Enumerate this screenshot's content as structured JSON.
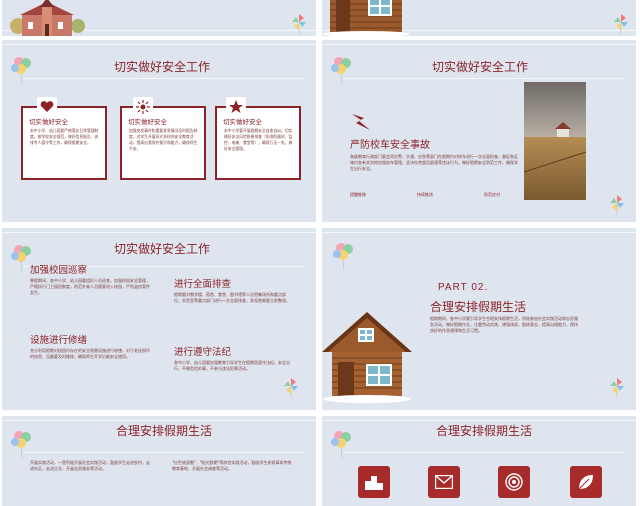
{
  "colors": {
    "accent": "#8b2328",
    "slide_bg": "#dfe5ee",
    "brand_red": "#a82b2b"
  },
  "slide3": {
    "title": "切实做好安全工作",
    "cards": [
      {
        "icon": "heart-icon",
        "title": "切实做好安全",
        "body": "本中小学、幼儿园要严格落实日常管理制度，按学校安全规范，做好信息报告、安排专人值守等工作，确保假期安全。"
      },
      {
        "icon": "sun-icon",
        "title": "切实做好安全",
        "body": "加强突发事件和重要紧急情况及时报告制度，对学生开展形式多样的安全教育活动，提高自我保护意识和能力，确保师生平安。"
      },
      {
        "icon": "star-icon",
        "title": "切实做好安全",
        "body": "本中小学要开展假期安全自查自纠，切实做好安全风险隐患排查（如消防器材、监控、电梯、食堂等），确保万无一失，做好安全管理。"
      }
    ]
  },
  "slide4": {
    "heading": "严防校车安全事故",
    "body": "各级教育行政部门要会同交警、交通、应急等部门在假期内对校车进行一次全面检查，督促各区域内各有关学校加强校车管理，坚决杜绝超员超速等违法行为，做好假期安全防范工作，确保学生出行安全。",
    "links": [
      "提醒推移",
      "持续推进",
      "防范应对"
    ]
  },
  "slide5": {
    "title": "切实做好安全工作",
    "items": [
      {
        "title": "加强校园巡察",
        "body": "寒假期间，各中小学、幼儿园要组织人员巡查，加强校园安全管理，严格执行门卫值班制度，防范外来人员随意进入校园，严防盗窃案件发生。"
      },
      {
        "title": "进行全面排查",
        "body": "假期要对教学楼、宿舍、食堂、图书馆等人员密集场所和重点部位，实验室等重点部门进行一次全面排查，发现隐患要立即整改。"
      },
      {
        "title": "设施进行修缮",
        "body": "充分利用假期对校园内存在的安全隐患设施进行修缮，对于老化损坏的校舍、设备要及时维修，确保师生开学后能安全使用。"
      },
      {
        "title": "进行遵守法纪",
        "body": "各中小学、幼儿园要加强教育引导学生在假期里遵守法纪，安全出行，不做危险的事，不参与违法犯罪活动。"
      }
    ]
  },
  "slide6": {
    "part": "PART 02.",
    "title": "合理安排假期生活",
    "body": "假期期间，各中小学要引导学生合理安排假期生活，积极参加社会实践活动和志愿服务活动，做好假期作业，注重劳动实践，增强体质，锻炼意志，提高自理能力，保持良好的作息规律和生活习惯。"
  },
  "slide7": {
    "title": "合理安排假期生活",
    "body_left": "开展实践活动，一是积极开展社会实践活动，鼓励学生走进农村，走进社区，走进企业，开展志愿服务等活动。",
    "body_right": "\"红色旅游圈\"、\"阳光假期\"等综合实践活动，鼓励学生参观革命传统教育基地，开展社会调查等活动。"
  },
  "slide8": {
    "title": "合理安排假期生活",
    "icons": [
      "podium-icon",
      "mail-icon",
      "target-icon",
      "leaf-icon"
    ]
  }
}
